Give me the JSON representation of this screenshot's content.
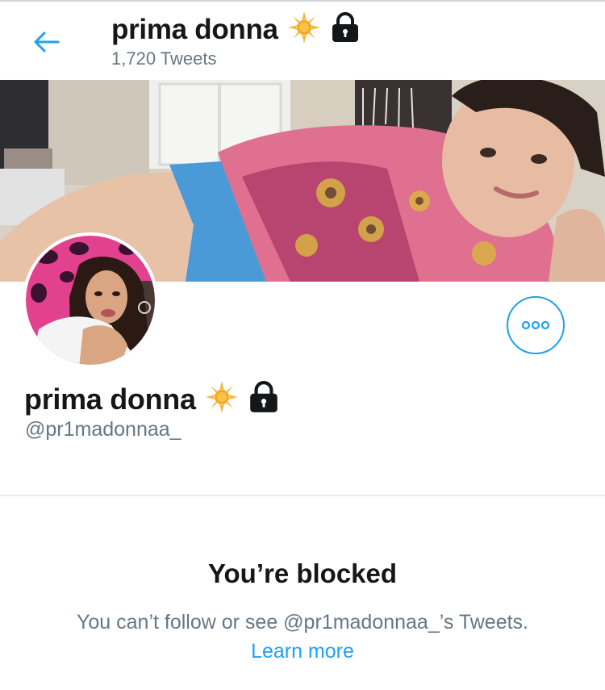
{
  "header": {
    "name": "prima donna",
    "tweet_count": "1,720 Tweets"
  },
  "profile": {
    "name": "prima donna",
    "handle": "@pr1madonnaa_"
  },
  "blocked": {
    "title": "You’re blocked",
    "description": "You can’t follow or see @pr1madonnaa_’s Tweets.",
    "learn_more": "Learn more"
  },
  "colors": {
    "accent": "#1da1f2",
    "secondary_text": "#657786",
    "primary_text": "#14171a",
    "divider": "#e6ecf0"
  },
  "icons": {
    "back": "arrow-left-icon",
    "badge_emoji": "sun-star-emoji-icon",
    "lock": "lock-icon",
    "more": "more-dots-icon"
  }
}
